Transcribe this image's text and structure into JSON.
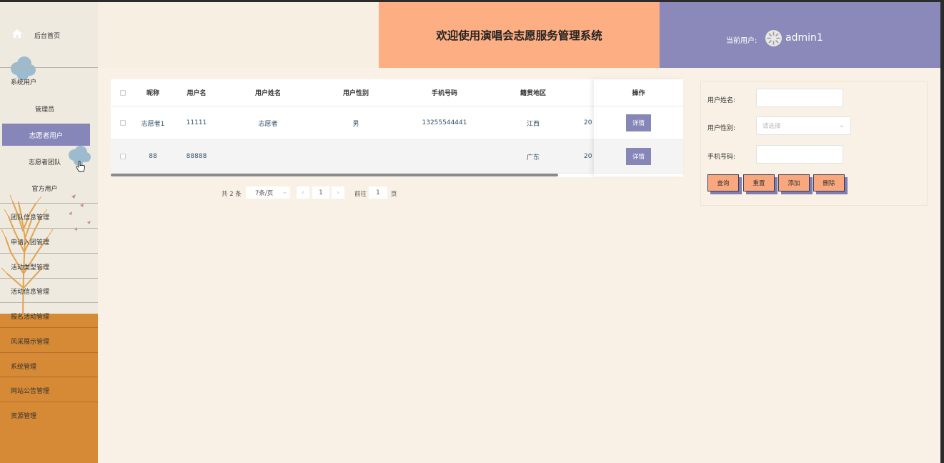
{
  "header": {
    "title": "欢迎使用演唱会志愿服务管理系统",
    "current_user_label": "当前用户:",
    "username": "admin1"
  },
  "sidebar": {
    "home": "后台首页",
    "items": [
      {
        "label": "系统用户"
      },
      {
        "label": "管理员"
      },
      {
        "label": "志愿者用户"
      },
      {
        "label": "志愿者团队"
      },
      {
        "label": "官方用户"
      },
      {
        "label": "团队信息管理"
      },
      {
        "label": "申请入团管理"
      },
      {
        "label": "活动类型管理"
      },
      {
        "label": "活动信息管理"
      },
      {
        "label": "报名活动管理"
      },
      {
        "label": "风采展示管理"
      },
      {
        "label": "系统管理"
      },
      {
        "label": "网站公告管理"
      },
      {
        "label": "资源管理"
      }
    ]
  },
  "table": {
    "columns": [
      "昵称",
      "用户名",
      "用户姓名",
      "用户性别",
      "手机号码",
      "籍贯地区",
      "操作"
    ],
    "rows": [
      {
        "nickname": "志愿者1",
        "username": "11111",
        "name": "志愿者",
        "gender": "男",
        "phone": "13255544441",
        "region": "江西",
        "extra": "20",
        "action": "详情"
      },
      {
        "nickname": "88",
        "username": "88888",
        "name": "",
        "gender": "",
        "phone": "",
        "region": "广东",
        "extra": "20",
        "action": "详情"
      }
    ]
  },
  "pagination": {
    "total": "共 2 条",
    "page_size": "7条/页",
    "current_page": "1",
    "goto_label": "前往",
    "goto_value": "1",
    "page_suffix": "页"
  },
  "search": {
    "name_label": "用户姓名:",
    "gender_label": "用户性别:",
    "gender_placeholder": "请选择",
    "phone_label": "手机号码:",
    "buttons": [
      "查询",
      "重置",
      "添加",
      "删除"
    ]
  },
  "colors": {
    "accent_purple": "#8786b9",
    "header_orange": "#fdae83",
    "sidebar_orange": "#d68a36",
    "page_bg": "#f9f1e5"
  }
}
